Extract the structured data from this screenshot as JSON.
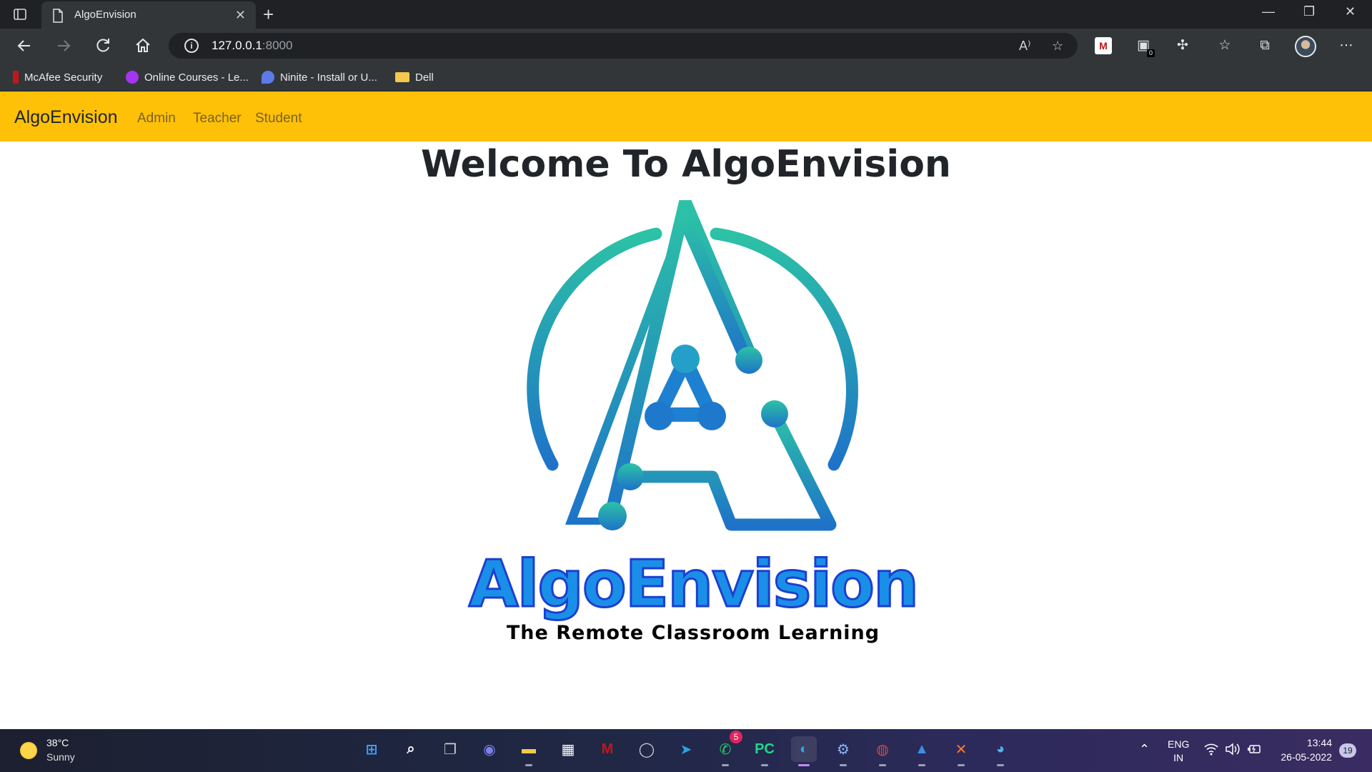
{
  "browser": {
    "tab_title": "AlgoEnvision",
    "url_host": "127.0.0.1",
    "url_port": ":8000",
    "new_tab_label": "+",
    "close_glyph": "✕",
    "minimize_glyph": "—",
    "restore_glyph": "❐",
    "window_close_glyph": "✕",
    "more_glyph": "⋯",
    "read_aloud_label": "A⁾",
    "extension_badge_count": "0",
    "icons": [
      "tab-actions-icon",
      "page-icon",
      "back-icon",
      "forward-icon",
      "refresh-icon",
      "home-icon",
      "info-icon",
      "read-aloud-icon",
      "add-favorite-icon",
      "mcafee-extension-icon",
      "extension-counter-icon",
      "extensions-icon",
      "favorites-icon",
      "collections-icon",
      "profile-avatar",
      "more-icon"
    ]
  },
  "bookmarks": [
    {
      "label": "McAfee Security",
      "icon": "mcafee-icon",
      "color": "#c01818"
    },
    {
      "label": "Online Courses - Le...",
      "icon": "udemy-icon",
      "color": "#a435f0"
    },
    {
      "label": "Ninite - Install or U...",
      "icon": "ninite-icon",
      "color": "#5b7be8"
    },
    {
      "label": "Dell",
      "icon": "folder-icon",
      "color": "#f2c94c"
    }
  ],
  "navbar": {
    "brand": "AlgoEnvision",
    "links": [
      "Admin",
      "Teacher",
      "Student"
    ],
    "background": "#ffc107"
  },
  "page": {
    "heading": "Welcome To AlgoEnvision",
    "logo_title": "AlgoEnvision",
    "logo_tagline": "The Remote Classroom Learning",
    "logo_colors": {
      "teal": "#2cc2a6",
      "blue": "#1e73c8",
      "text_fill": "#1a8fe8"
    }
  },
  "taskbar": {
    "weather_temp": "38°C",
    "weather_desc": "Sunny",
    "apps": [
      {
        "name": "start",
        "glyph": "⊞",
        "color": "#3aa0ff"
      },
      {
        "name": "search",
        "glyph": "⌕",
        "color": "#ffffff"
      },
      {
        "name": "task-view",
        "glyph": "❐",
        "color": "#d0d0d0"
      },
      {
        "name": "teams-chat",
        "glyph": "◉",
        "color": "#7b83eb"
      },
      {
        "name": "file-explorer",
        "glyph": "▬",
        "color": "#f2c94c"
      },
      {
        "name": "microsoft-store",
        "glyph": "▦",
        "color": "#ffffff"
      },
      {
        "name": "mcafee",
        "glyph": "M",
        "color": "#c01818"
      },
      {
        "name": "dell",
        "glyph": "◯",
        "color": "#d0d0d0"
      },
      {
        "name": "telegram",
        "glyph": "➤",
        "color": "#2aa3e0"
      },
      {
        "name": "whatsapp",
        "glyph": "✆",
        "color": "#25d366",
        "badge": "5"
      },
      {
        "name": "pycharm",
        "glyph": "PC",
        "color": "#21d789"
      },
      {
        "name": "edge",
        "glyph": "◐",
        "color": "#28a9e0"
      },
      {
        "name": "settings",
        "glyph": "⚙",
        "color": "#8ab4f8"
      },
      {
        "name": "chrome",
        "glyph": "◍",
        "color": "#ea4335"
      },
      {
        "name": "photos",
        "glyph": "▲",
        "color": "#3a8ee6"
      },
      {
        "name": "xampp",
        "glyph": "✕",
        "color": "#fb7a24"
      },
      {
        "name": "earth",
        "glyph": "◕",
        "color": "#4fb0e8"
      }
    ],
    "tray_chevron": "^",
    "language": "ENG",
    "region": "IN",
    "wifi_glyph": "◠",
    "volume_glyph": "◀)",
    "battery_glyph": "▭",
    "time": "13:44",
    "date": "26-05-2022",
    "notification_count": "19"
  }
}
